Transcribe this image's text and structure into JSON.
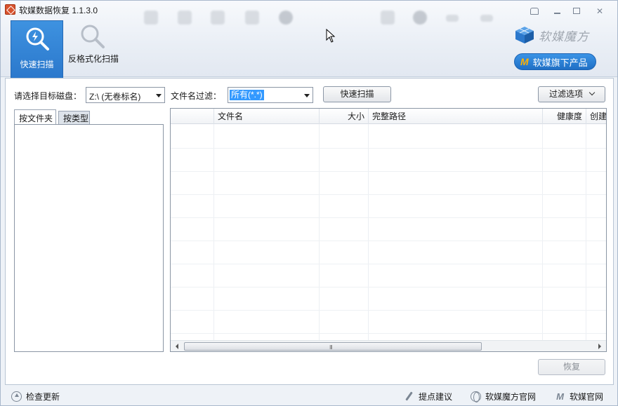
{
  "app": {
    "title": "软媒数据恢复 1.1.3.0"
  },
  "header": {
    "tabs": [
      {
        "label": "快速扫描",
        "active": true
      },
      {
        "label": "反格式化扫描",
        "active": false
      }
    ],
    "brand_text": "软媒魔方",
    "products_button": "软媒旗下产品",
    "products_badge": "M"
  },
  "controls": {
    "disk_label": "请选择目标磁盘：",
    "disk_value": "Z:\\  (无卷标名)",
    "filter_label": "文件名过滤：",
    "filter_value": "所有(*.*)",
    "scan_button": "快速扫描",
    "filter_options_button": "过滤选项"
  },
  "left_pane": {
    "tabs": [
      {
        "label": "按文件夹",
        "active": true
      },
      {
        "label": "按类型",
        "active": false
      }
    ]
  },
  "file_list": {
    "columns": [
      "",
      "文件名",
      "大小",
      "完整路径",
      "健康度",
      "创建"
    ],
    "rows": [],
    "scroll_glyph": "III"
  },
  "recover_button": "恢复",
  "statusbar": {
    "check_update": "检查更新",
    "suggest": "提点建议",
    "mofang_site": "软媒魔方官网",
    "ruanmei_site": "软媒官网",
    "ruanmei_badge": "M"
  },
  "colors": {
    "accent_blue": "#2b78cc",
    "selection_blue": "#3399ff",
    "badge_orange": "#ffb100"
  },
  "icons": [
    "app-icon",
    "search-icon",
    "search-icon",
    "cube-logo-icon",
    "update-icon",
    "pen-icon",
    "globe-icon",
    "m-logo-icon"
  ]
}
